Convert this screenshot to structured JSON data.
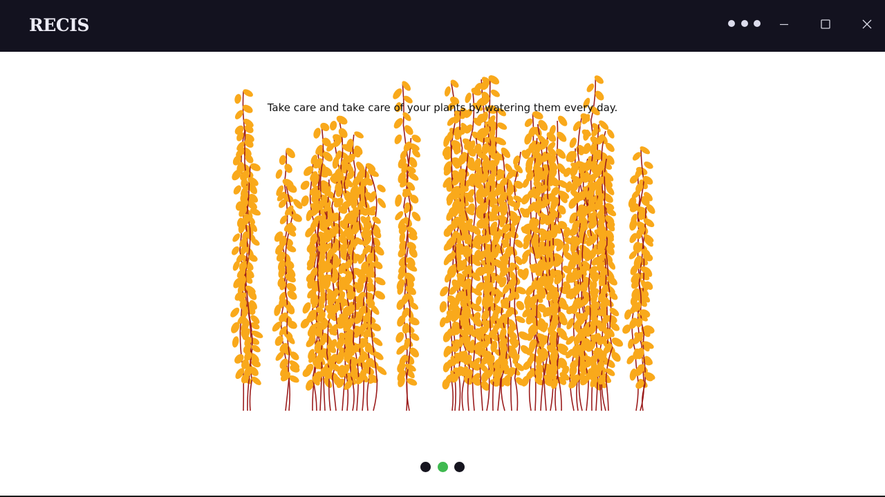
{
  "window": {
    "brand": "RECIS",
    "more_icon": "more-horizontal-icon",
    "minimize_icon": "minimize-icon",
    "maximize_icon": "maximize-icon",
    "close_icon": "close-icon"
  },
  "slide": {
    "caption": "Take care and take care of your plants by watering them every day.",
    "illustration_icon": "plant-stems-illustration"
  },
  "pager": {
    "count": 3,
    "active_index": 1,
    "dot_color": "#16151f",
    "active_color": "#3fb950"
  },
  "colors": {
    "titlebar": "#13121f",
    "leaf": "#f9a91b",
    "stem": "#9b1c1c"
  }
}
